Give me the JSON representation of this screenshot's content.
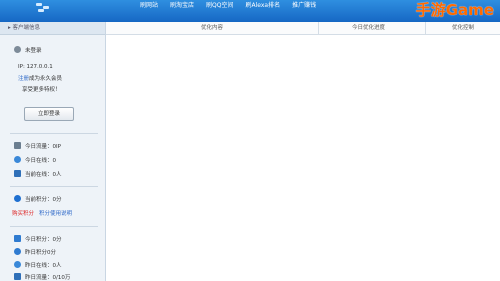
{
  "topbar": {
    "nav": [
      "刷网站",
      "刷淘宝店",
      "刷QQ空间",
      "刷Alexa排名",
      "推广赚钱"
    ],
    "brand": "手游Game"
  },
  "sidebar": {
    "header": "客户端信息",
    "user_status": "未登录",
    "ip": "IP: 127.0.0.1",
    "register_link": "注册",
    "register_text": "成为永久会员",
    "privilege_text": "享受更多特权！",
    "login_button": "立即登录",
    "today_traffic": "今日流量：0IP",
    "today_online": "今日在线：0",
    "current_online": "当前在线：0人",
    "current_points": "当前积分：0分",
    "buy_points": "购买积分",
    "points_usage": "积分使用说明",
    "today_points": "今日积分：0分",
    "yesterday_points": "昨日积分0分",
    "yesterday_online": "昨日在线：0人",
    "yesterday_traffic": "昨日流量：0/10万"
  },
  "table": {
    "columns": [
      "优化内容",
      "今日优化进度",
      "优化控制"
    ]
  }
}
